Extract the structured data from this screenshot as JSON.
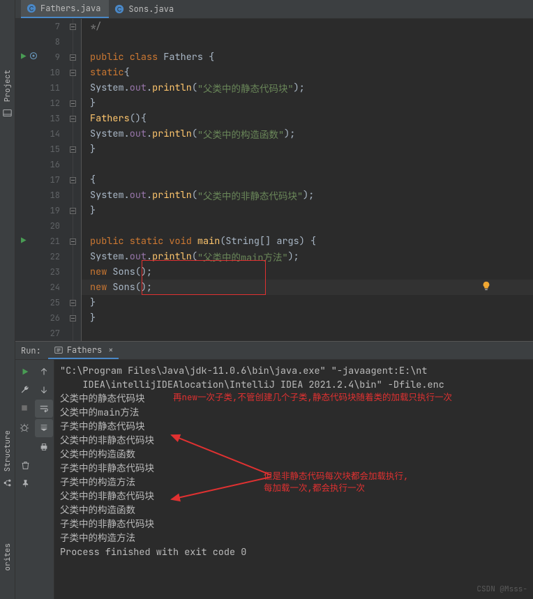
{
  "sidebar": {
    "labels": [
      "Project",
      "Structure",
      "orites"
    ]
  },
  "tabs": [
    {
      "label": "Fathers.java",
      "active": true
    },
    {
      "label": "Sons.java",
      "active": false
    }
  ],
  "editor": {
    "lines": [
      {
        "n": 7,
        "indent": "        ",
        "tokens": [
          [
            "cmt",
            "*/"
          ]
        ],
        "fold_end": true
      },
      {
        "n": 8,
        "indent": "",
        "tokens": []
      },
      {
        "n": 9,
        "indent": "    ",
        "tokens": [
          [
            "kw",
            "public class "
          ],
          [
            "cls",
            "Fathers "
          ],
          [
            "pun",
            "{"
          ]
        ],
        "run": true,
        "fold_start": true
      },
      {
        "n": 10,
        "indent": "        ",
        "tokens": [
          [
            "kw",
            "static"
          ],
          [
            "pun",
            "{"
          ]
        ],
        "fold_start": true
      },
      {
        "n": 11,
        "indent": "            ",
        "tokens": [
          [
            "cls",
            "System"
          ],
          [
            "pun",
            "."
          ],
          [
            "field",
            "out"
          ],
          [
            "pun",
            "."
          ],
          [
            "fn",
            "println"
          ],
          [
            "pun",
            "("
          ],
          [
            "str",
            "\"父类中的静态代码块\""
          ],
          [
            "pun",
            ");"
          ]
        ]
      },
      {
        "n": 12,
        "indent": "        ",
        "tokens": [
          [
            "pun",
            "}"
          ]
        ],
        "fold_end": true
      },
      {
        "n": 13,
        "indent": "        ",
        "tokens": [
          [
            "fn",
            "Fathers"
          ],
          [
            "pun",
            "(){"
          ]
        ],
        "fold_start": true
      },
      {
        "n": 14,
        "indent": "            ",
        "tokens": [
          [
            "cls",
            "System"
          ],
          [
            "pun",
            "."
          ],
          [
            "field",
            "out"
          ],
          [
            "pun",
            "."
          ],
          [
            "fn",
            "println"
          ],
          [
            "pun",
            "("
          ],
          [
            "str",
            "\"父类中的构造函数\""
          ],
          [
            "pun",
            ");"
          ]
        ]
      },
      {
        "n": 15,
        "indent": "        ",
        "tokens": [
          [
            "pun",
            "}"
          ]
        ],
        "fold_end": true
      },
      {
        "n": 16,
        "indent": "",
        "tokens": []
      },
      {
        "n": 17,
        "indent": "        ",
        "tokens": [
          [
            "pun",
            "{"
          ]
        ],
        "fold_start": true
      },
      {
        "n": 18,
        "indent": "            ",
        "tokens": [
          [
            "cls",
            "System"
          ],
          [
            "pun",
            "."
          ],
          [
            "field",
            "out"
          ],
          [
            "pun",
            "."
          ],
          [
            "fn",
            "println"
          ],
          [
            "pun",
            "("
          ],
          [
            "str",
            "\"父类中的非静态代码块\""
          ],
          [
            "pun",
            ");"
          ]
        ]
      },
      {
        "n": 19,
        "indent": "        ",
        "tokens": [
          [
            "pun",
            "}"
          ]
        ],
        "fold_end": true
      },
      {
        "n": 20,
        "indent": "",
        "tokens": []
      },
      {
        "n": 21,
        "indent": "        ",
        "tokens": [
          [
            "kw",
            "public static void "
          ],
          [
            "fn",
            "main"
          ],
          [
            "pun",
            "("
          ],
          [
            "cls",
            "String"
          ],
          [
            "pun",
            "[] "
          ],
          [
            "param",
            "args"
          ],
          [
            "pun",
            ") {"
          ]
        ],
        "run": true,
        "fold_start": true
      },
      {
        "n": 22,
        "indent": "            ",
        "tokens": [
          [
            "cls",
            "System"
          ],
          [
            "pun",
            "."
          ],
          [
            "field",
            "out"
          ],
          [
            "pun",
            "."
          ],
          [
            "fn",
            "println"
          ],
          [
            "pun",
            "("
          ],
          [
            "str",
            "\"父类中的main方法\""
          ],
          [
            "pun",
            ");"
          ]
        ]
      },
      {
        "n": 23,
        "indent": "            ",
        "tokens": [
          [
            "kw",
            "new "
          ],
          [
            "cls",
            "Sons"
          ],
          [
            "pun",
            "();"
          ]
        ]
      },
      {
        "n": 24,
        "indent": "            ",
        "tokens": [
          [
            "kw",
            "new "
          ],
          [
            "cls",
            "Sons"
          ],
          [
            "pun",
            "();"
          ]
        ],
        "hl": true,
        "bulb": true
      },
      {
        "n": 25,
        "indent": "        ",
        "tokens": [
          [
            "pun",
            "}"
          ]
        ],
        "fold_end": true
      },
      {
        "n": 26,
        "indent": "    ",
        "tokens": [
          [
            "pun",
            "}"
          ]
        ],
        "fold_end": true
      },
      {
        "n": 27,
        "indent": "",
        "tokens": []
      }
    ]
  },
  "run": {
    "title": "Run:",
    "tab": "Fathers",
    "lines": [
      "\"C:\\Program Files\\Java\\jdk-11.0.6\\bin\\java.exe\" \"-javaagent:E:\\nt",
      " IDEA\\intellijIDEAlocation\\IntelliJ IDEA 2021.2.4\\bin\" -Dfile.enc",
      "父类中的静态代码块",
      "父类中的main方法",
      "子类中的静态代码块",
      "父类中的非静态代码块",
      "父类中的构造函数",
      "子类中的非静态代码块",
      "子类中的构造方法",
      "父类中的非静态代码块",
      "父类中的构造函数",
      "子类中的非静态代码块",
      "子类中的构造方法",
      "",
      "Process finished with exit code 0"
    ]
  },
  "annotations": {
    "a1": "再new一次子类,不管创建几个子类,静态代码块随着类的加载只执行一次",
    "a2_l1": "但是非静态代码每次块都会加载执行,",
    "a2_l2": "每加载一次,都会执行一次"
  },
  "watermark": "CSDN @Msss-"
}
